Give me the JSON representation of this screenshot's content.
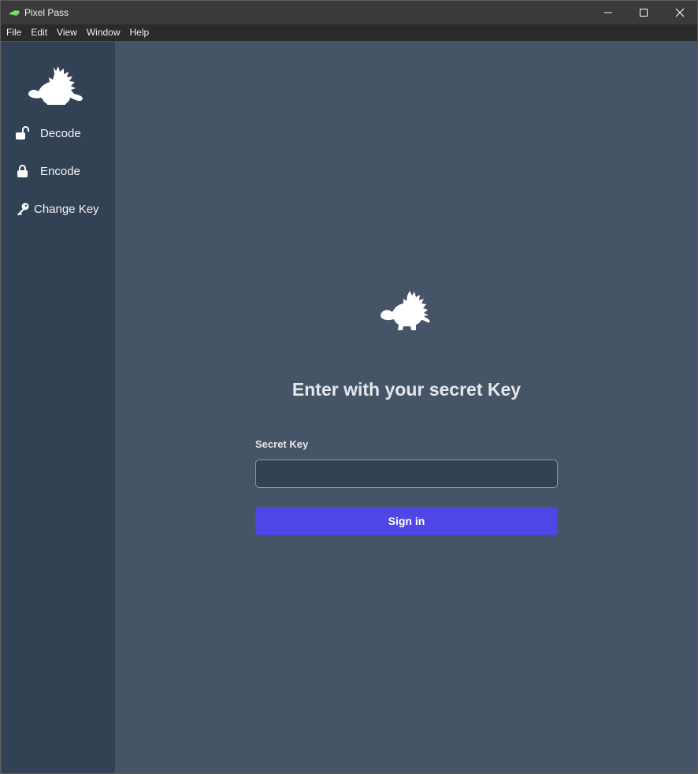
{
  "window": {
    "title": "Pixel Pass",
    "icon": "stegosaurus-icon"
  },
  "menubar": {
    "items": [
      "File",
      "Edit",
      "View",
      "Window",
      "Help"
    ]
  },
  "sidebar": {
    "logo_icon": "stegosaurus-icon",
    "items": [
      {
        "label": "Decode",
        "icon": "unlock-icon"
      },
      {
        "label": "Encode",
        "icon": "lock-icon"
      },
      {
        "label": "Change Key",
        "icon": "key-icon"
      }
    ]
  },
  "main": {
    "logo_icon": "stegosaurus-icon",
    "heading": "Enter with your secret Key",
    "secret_key_label": "Secret Key",
    "secret_key_value": "",
    "secret_key_placeholder": "",
    "sign_in_label": "Sign in"
  },
  "colors": {
    "sidebar_bg": "#334155",
    "main_bg": "#465467",
    "accent": "#4f46e5",
    "titlebar_bg": "#3a3a3a",
    "menubar_bg": "#2b2b2b"
  }
}
